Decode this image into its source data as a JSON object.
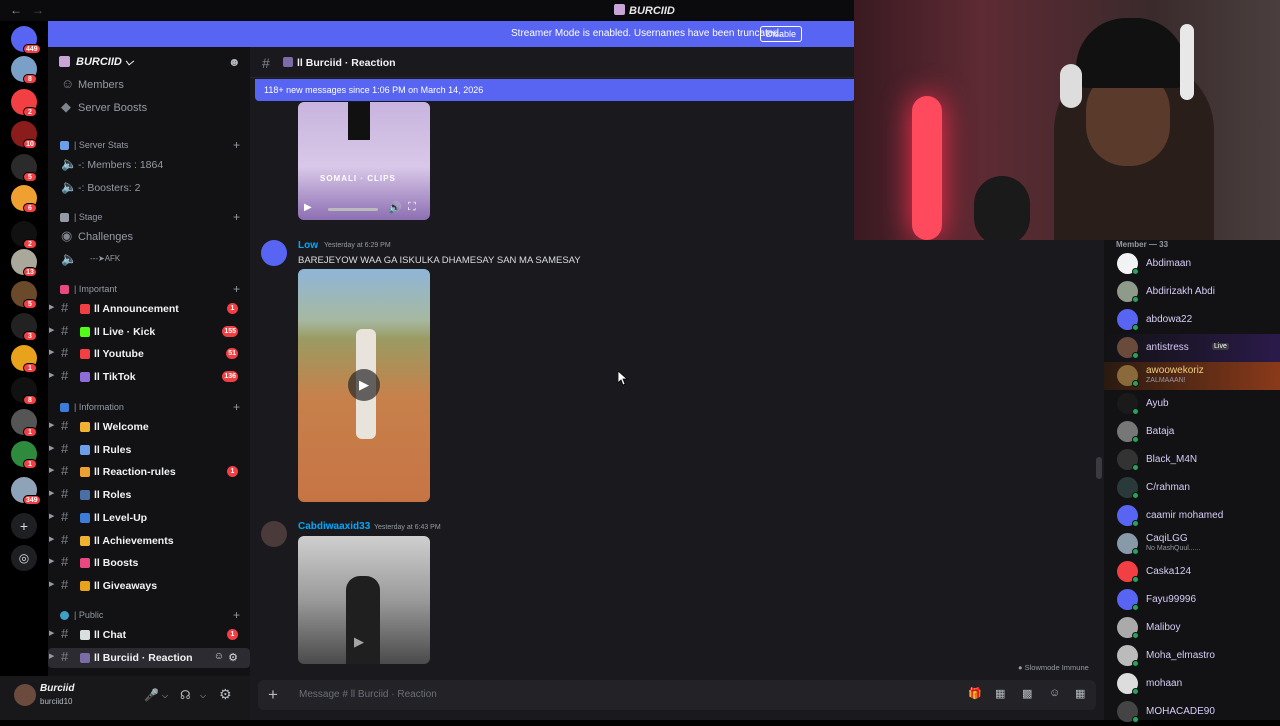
{
  "window": {
    "title": "BURCIID"
  },
  "streamer_banner": {
    "text": "Streamer Mode is enabled. Usernames have been truncated.",
    "button": "Disable"
  },
  "guilds": [
    {
      "badge": "449",
      "color": "#5865f2"
    },
    {
      "badge": "8",
      "color": "#7aa0c7"
    },
    {
      "badge": "2",
      "color": "#f23f43"
    },
    {
      "badge": "10",
      "color": "#8a1c1c"
    },
    {
      "badge": "5",
      "color": "#2b2b2b"
    },
    {
      "badge": "6",
      "color": "#f0a030"
    },
    {
      "badge": "2",
      "color": "#111111"
    },
    {
      "badge": "13",
      "color": "#aaa89a"
    },
    {
      "badge": "5",
      "color": "#6a4a2a"
    },
    {
      "badge": "3",
      "color": "#222222"
    },
    {
      "badge": "1",
      "color": "#e8a21b"
    },
    {
      "badge": "8",
      "color": "#111111"
    },
    {
      "badge": "1",
      "color": "#555555"
    },
    {
      "badge": "1",
      "color": "#2e8b3e"
    },
    {
      "badge": "349",
      "color": "#8fa3b8"
    }
  ],
  "server": {
    "name": "BURCIID"
  },
  "sidebar": {
    "top_items": [
      "Members",
      "Server Boosts"
    ],
    "categories": {
      "server_stats": "| Server Stats",
      "stage": "| Stage",
      "important": "| Important",
      "information": "| Information",
      "public": "| Public"
    },
    "stats": [
      "-: Members : 1864",
      "-: Boosters: 2"
    ],
    "stage_items": [
      "Challenges",
      "---➤AFK"
    ],
    "important": [
      {
        "label": "ll Announcement",
        "count": "1",
        "color": "#f23f43"
      },
      {
        "label": "ll Live · Kick",
        "count": "155",
        "color": "#53fc18"
      },
      {
        "label": "ll Youtube",
        "count": "51",
        "color": "#f23f43"
      },
      {
        "label": "ll TikTok",
        "count": "136",
        "color": "#8f6cd9"
      }
    ],
    "information": [
      {
        "label": "ll Welcome",
        "count": "",
        "color": "#f0b232"
      },
      {
        "label": "ll Rules",
        "count": "",
        "color": "#6d9ee8"
      },
      {
        "label": "ll Reaction-rules",
        "count": "1",
        "color": "#f0a030"
      },
      {
        "label": "ll Roles",
        "count": "",
        "color": "#4a6fa5"
      },
      {
        "label": "ll Level-Up",
        "count": "",
        "color": "#3c7dd9"
      },
      {
        "label": "ll Achievements",
        "count": "",
        "color": "#f0b232"
      },
      {
        "label": "ll Boosts",
        "count": "",
        "color": "#e84a7f"
      },
      {
        "label": "ll Giveaways",
        "count": "",
        "color": "#e8a21b"
      }
    ],
    "public": [
      {
        "label": "ll Chat",
        "count": "1",
        "color": "#dbdee1"
      },
      {
        "label": "ll Burciid · Reaction",
        "count": "",
        "color": "#7b6ca8"
      }
    ]
  },
  "user": {
    "name": "Burciid",
    "status": "burciid10"
  },
  "channel": {
    "name": "ll Burciid · Reaction"
  },
  "new_messages_bar": "118+ new messages since 1:06 PM on March 14, 2026",
  "video_overlay_text": "SOMALI · CLIPS",
  "messages": [
    {
      "author": "Low",
      "time": "Yesterday at 6:29 PM",
      "text": "BAREJEYOW WAA GA ISKULKA DHAMESAY SAN MA SAMESAY",
      "color": "#00a8fc"
    },
    {
      "author": "Cabdiwaaxid33",
      "time": "Yesterday at 6:43 PM",
      "text": "",
      "color": "#00a8fc"
    }
  ],
  "slowmode": "Slowmode Immune",
  "composer": {
    "placeholder": "Message # ll Burciid · Reaction"
  },
  "members": {
    "header": "Member — 33",
    "list": [
      {
        "name": "Abdimaan",
        "sub": "",
        "color": "#d8cdf7",
        "av": "#f2f3f5"
      },
      {
        "name": "Abdirizakh Abdi",
        "sub": "",
        "color": "#d8cdf7",
        "av": "#8e9a8a"
      },
      {
        "name": "abdowa22",
        "sub": "",
        "color": "#d8cdf7",
        "av": "#5865f2"
      },
      {
        "name": "antistress",
        "sub": "",
        "color": "#d8cdf7",
        "av": "#6a4a3a",
        "live": "Live"
      },
      {
        "name": "awoowekoriz",
        "sub": "ZALMAAAN!",
        "color": "#f0d080",
        "av": "#8a6a3a"
      },
      {
        "name": "Ayub",
        "sub": "",
        "color": "#d8cdf7",
        "av": "#1a1a1a"
      },
      {
        "name": "Bataja",
        "sub": "",
        "color": "#d8cdf7",
        "av": "#777777"
      },
      {
        "name": "Black_M4N",
        "sub": "",
        "color": "#d8cdf7",
        "av": "#333333"
      },
      {
        "name": "C/rahman",
        "sub": "",
        "color": "#d8cdf7",
        "av": "#2a3a3a"
      },
      {
        "name": "caamir mohamed",
        "sub": "",
        "color": "#d8cdf7",
        "av": "#5865f2"
      },
      {
        "name": "CaqiLGG",
        "sub": "No MashQuul......",
        "color": "#d8cdf7",
        "av": "#8899aa"
      },
      {
        "name": "Caska124",
        "sub": "",
        "color": "#d8cdf7",
        "av": "#f23f43"
      },
      {
        "name": "Fayu99996",
        "sub": "",
        "color": "#d8cdf7",
        "av": "#5865f2"
      },
      {
        "name": "Maliboy",
        "sub": "",
        "color": "#d8cdf7",
        "av": "#aaaaaa"
      },
      {
        "name": "Moha_elmastro",
        "sub": "",
        "color": "#d8cdf7",
        "av": "#bbbbbb"
      },
      {
        "name": "mohaan",
        "sub": "",
        "color": "#d8cdf7",
        "av": "#dddddd"
      },
      {
        "name": "MOHACADE90",
        "sub": "",
        "color": "#d8cdf7",
        "av": "#444444"
      }
    ]
  }
}
